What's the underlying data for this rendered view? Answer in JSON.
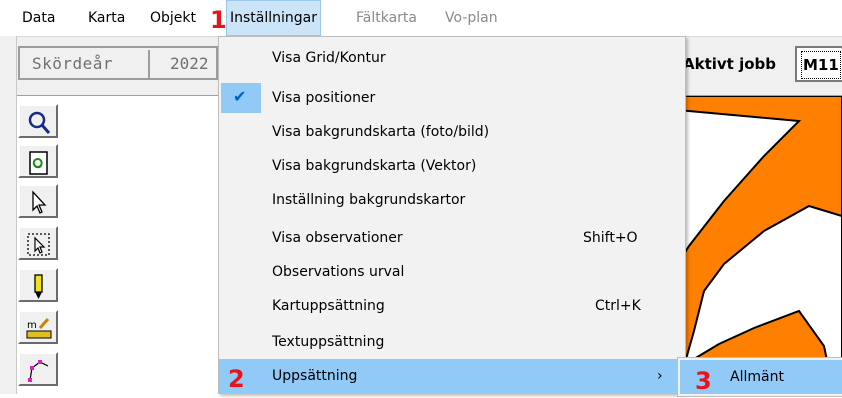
{
  "menubar": {
    "items": [
      {
        "label": "Data"
      },
      {
        "label": "Karta"
      },
      {
        "label": "Objekt"
      },
      {
        "label": "Inställningar"
      },
      {
        "label": "Fältkarta"
      },
      {
        "label": "Vo-plan"
      }
    ]
  },
  "toolbar": {
    "season_label": "Skördeår",
    "season_year": "2022",
    "active_job_label": "Aktivt jobb",
    "active_job_value": "M11"
  },
  "tools": [
    {
      "icon": "magnifier-icon"
    },
    {
      "icon": "refresh-document-icon"
    },
    {
      "icon": "pointer-arrow-icon"
    },
    {
      "icon": "select-area-icon"
    },
    {
      "icon": "pencil-icon"
    },
    {
      "icon": "measure-ruler-icon"
    },
    {
      "icon": "polygon-edit-icon"
    }
  ],
  "dropdown": {
    "items": [
      {
        "label": "Visa Grid/Kontur",
        "checked": false,
        "shortcut": ""
      },
      {
        "label": "Visa positioner",
        "checked": true,
        "shortcut": ""
      },
      {
        "label": "Visa bakgrundskarta (foto/bild)",
        "checked": false,
        "shortcut": ""
      },
      {
        "label": "Visa bakgrundskarta (Vektor)",
        "checked": false,
        "shortcut": ""
      },
      {
        "label": "Inställning bakgrundskartor",
        "checked": false,
        "shortcut": ""
      },
      {
        "label": "Visa observationer",
        "checked": false,
        "shortcut": "Shift+O"
      },
      {
        "label": "Observations urval",
        "checked": false,
        "shortcut": ""
      },
      {
        "label": "Kartuppsättning",
        "checked": false,
        "shortcut": "Ctrl+K"
      },
      {
        "label": "Textuppsättning",
        "checked": false,
        "shortcut": ""
      },
      {
        "label": "Uppsättning",
        "checked": false,
        "shortcut": "",
        "submenu": true
      }
    ],
    "submenu_arrow": "›"
  },
  "submenu": {
    "items": [
      {
        "label": "Allmänt"
      }
    ]
  },
  "annotations": {
    "step1": "1",
    "step2": "2",
    "step3": "3"
  },
  "colors": {
    "highlight": "#91c9f7",
    "menu_bg": "#f2f2f2",
    "map_field": "#ff7f00",
    "annotation_red": "#e8141c"
  }
}
